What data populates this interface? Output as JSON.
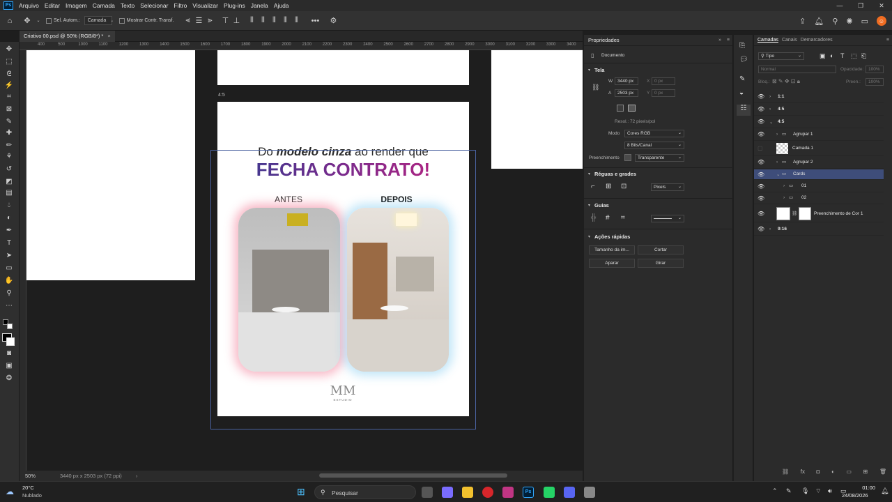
{
  "menu": {
    "items": [
      "Arquivo",
      "Editar",
      "Imagem",
      "Camada",
      "Texto",
      "Selecionar",
      "Filtro",
      "Visualizar",
      "Plug-ins",
      "Janela",
      "Ajuda"
    ]
  },
  "options": {
    "auto_select_label": "Sel. Autom.:",
    "auto_select_value": "Camada",
    "transform_label": "Mostrar Contr. Transf.",
    "more": "•••"
  },
  "document": {
    "tab_title": "Criativo 00.psd @ 50% (RGB/8*) *",
    "tab_close": "×",
    "artboard_label": "4:5",
    "zoom": "50%",
    "status_info": "3440 px x 2503 px (72 ppi)"
  },
  "ruler": {
    "ticks": [
      "400",
      "500",
      "1000",
      "1100",
      "1200",
      "1300",
      "1400",
      "1500",
      "1600",
      "1700",
      "1800",
      "1900",
      "2000",
      "2100",
      "2200",
      "2300",
      "2400",
      "2500",
      "2600",
      "2700",
      "2800",
      "2900",
      "3000",
      "3100",
      "3200",
      "3300",
      "3400"
    ]
  },
  "design": {
    "line1_a": "Do ",
    "line1_b": "modelo cinza",
    "line1_c": " ao render que",
    "line2": "FECHA CONTRATO!",
    "before": "ANTES",
    "after": "DEPOIS",
    "logo_text": "MM",
    "logo_sub": "ESTUDIO"
  },
  "properties": {
    "title": "Propriedades",
    "doc": "Documento",
    "canvas_section": "Tela",
    "w_label": "W",
    "w_value": "3440 px",
    "x_label": "X",
    "x_value": "0 px",
    "h_label": "A",
    "h_value": "2503 px",
    "y_label": "Y",
    "y_value": "0 px",
    "resolution": "Resol.: 72 pixels/pol",
    "mode_label": "Modo",
    "mode_value": "Cores RGB",
    "bits_value": "8 Bits/Canal",
    "fill_label": "Preenchimento",
    "fill_value": "Transparente",
    "rulers_section": "Réguas e grades",
    "units_value": "Pixels",
    "guides_section": "Guias",
    "quick_section": "Ações rápidas",
    "btn_image_size": "Tamanho da im...",
    "btn_crop": "Cortar",
    "btn_trim": "Aparar",
    "btn_rotate": "Girar"
  },
  "layers": {
    "tabs": [
      "Camadas",
      "Canais",
      "Demarcadores"
    ],
    "filter": "Tipo",
    "blend": "Normal",
    "opacity_label": "Opacidade:",
    "opacity_value": "100%",
    "lock_label": "Bloq.:",
    "fill_label": "Preen.:",
    "fill_value": "100%",
    "rows": [
      "1:1",
      "4:5",
      "4:5",
      "Agrupar 1",
      "Camada 1",
      "Agrupar 2",
      "Cards",
      "01",
      "02",
      "Preenchimento de Cor 1",
      "9:16"
    ]
  },
  "taskbar": {
    "temp": "20°C",
    "weather": "Nublado",
    "search": "Pesquisar",
    "time": "01:00",
    "date": "24/08/2026"
  }
}
